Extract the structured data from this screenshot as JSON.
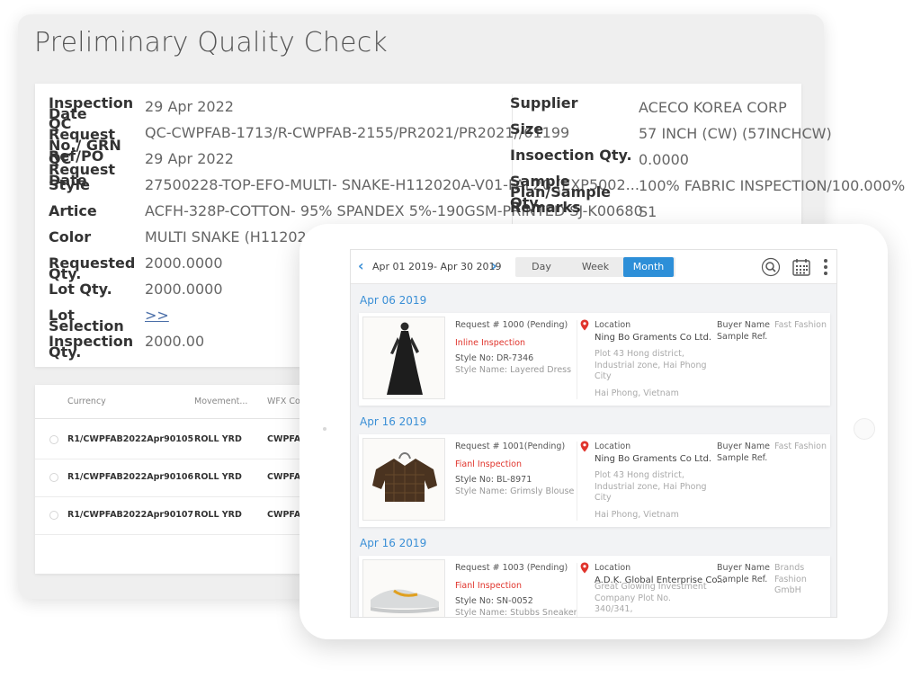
{
  "page_title": "Preliminary Quality Check",
  "left_fields": [
    {
      "label": "Inspection Date",
      "value": "29 Apr 2022"
    },
    {
      "label": "QC Request No./ GRN Ref/PO",
      "value": "QC-CWPFAB-1713/R-CWPFAB-2155/PR2021/PR2021//61199"
    },
    {
      "label": "QC Request Date",
      "value": "29 Apr 2022"
    },
    {
      "label": "Style",
      "value": "27500228-TOP-EFO-MULTI- SNAKE-H112020A-V01-FAL20 (EXP5002..."
    },
    {
      "label": "Artice",
      "value": "ACFH-328P-COTTON- 95% SPANDEX 5%-190GSM-PRINTED SJ-K00680"
    },
    {
      "label": "Color",
      "value": "MULTI SNAKE (H1120201A)"
    },
    {
      "label": "Requested Qty.",
      "value": "2000.0000"
    },
    {
      "label": "Lot Qty.",
      "value": "2000.0000"
    },
    {
      "label": "Lot Selection",
      "value": ">>"
    },
    {
      "label": "Inspection Qty.",
      "value": "2000.00"
    }
  ],
  "right_fields": [
    {
      "label": "Supplier",
      "value": "ACECO KOREA CORP"
    },
    {
      "label": "Size",
      "value": "57 INCH (CW) (57INCHCW)"
    },
    {
      "label": "Insoection Qty.",
      "value": "0.0000"
    },
    {
      "label": "Sample Plan/Sample Qty.",
      "value": "100% FABRIC INSPECTION/100.000%"
    },
    {
      "label": "Remarks",
      "value": "S1"
    }
  ],
  "grid": {
    "headers": [
      "Currency",
      "Movement...",
      "WFX Co"
    ],
    "rows": [
      {
        "ref": "R1/CWPFAB2022Apr90105",
        "uom": "ROLL YRD",
        "code": "CWPFA"
      },
      {
        "ref": "R1/CWPFAB2022Apr90106",
        "uom": "ROLL YRD",
        "code": "CWPFA"
      },
      {
        "ref": "R1/CWPFAB2022Apr90107",
        "uom": "ROLL YRD",
        "code": "CWPFA"
      }
    ]
  },
  "tablet": {
    "date_range": "Apr 01 2019- Apr 30 2019",
    "views": [
      "Day",
      "Week",
      "Month"
    ],
    "active_view": "Month",
    "accent_color": "#2d8fd8",
    "alert_color": "#e0342c",
    "groups": [
      {
        "date": "Apr 06 2019",
        "request": "Request # 1000 (Pending)",
        "inspection": "Inline Inspection",
        "style_no": "Style No: DR-7346",
        "style_name": "Style Name: Layered Dress",
        "location_label": "Location",
        "location_name": "Ning Bo Graments Co Ltd.",
        "address": "Plot 43 Hong district, Industrial zone, Hai Phong City",
        "city": "Hai Phong, Vietnam",
        "buyer_label": "Buyer Name",
        "buyer_value": "Fast Fashion",
        "sample_label": "Sample Ref.",
        "thumb_icon": "dress-image"
      },
      {
        "date": "Apr 16 2019",
        "request": "Request # 1001(Pending)",
        "inspection": "Fianl Inspection",
        "style_no": "Style No: BL-8971",
        "style_name": "Style Name: Grimsly Blouse",
        "location_label": "Location",
        "location_name": "Ning Bo Graments Co Ltd.",
        "address": "Plot 43 Hong district, Industrial zone, Hai Phong City",
        "city": "Hai Phong, Vietnam",
        "buyer_label": "Buyer Name",
        "buyer_value": "Fast Fashion",
        "sample_label": "Sample Ref.",
        "thumb_icon": "blouse-image"
      },
      {
        "date": "Apr 16 2019",
        "request": "Request # 1003 (Pending)",
        "inspection": "Fianl Inspection",
        "style_no": "Style No: SN-0052",
        "style_name": "Style Name: Stubbs Sneaker",
        "location_label": "Location",
        "location_name": "A.D.K. Global Enterprise Co...",
        "address": "Great Glowing Investment Company Plot No. 340/341,",
        "city": "",
        "buyer_label": "Buyer Name",
        "buyer_value": "Brands Fashion GmbH",
        "sample_label": "Sample Ref.",
        "thumb_icon": "sneaker-image"
      }
    ]
  }
}
